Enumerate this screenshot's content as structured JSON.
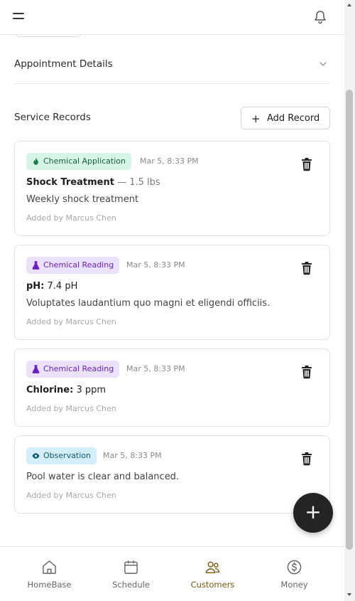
{
  "header": {
    "menu_icon": "hamburger-menu-icon",
    "notifications_icon": "bell-icon"
  },
  "appointment": {
    "title": "Appointment Details",
    "chevron_icon": "chevron-down-icon"
  },
  "service_records": {
    "title": "Service Records",
    "add_button": {
      "icon": "plus-icon",
      "label": "Add Record"
    },
    "records": [
      {
        "type": "Chemical Application",
        "type_icon": "flame-icon",
        "badge_color": "#d7f5e6",
        "timestamp": "Mar 5, 8:33 PM",
        "main_label": "Shock Treatment",
        "main_value": "— 1.5 lbs",
        "note": "Weekly shock treatment",
        "added_by": "Added by Marcus Chen"
      },
      {
        "type": "Chemical Reading",
        "type_icon": "flask-icon",
        "badge_color": "#ece1fb",
        "timestamp": "Mar 5, 8:33 PM",
        "main_label": "pH:",
        "main_value": "7.4 pH",
        "note": "Voluptates laudantium quo magni et eligendi officiis.",
        "added_by": "Added by Marcus Chen"
      },
      {
        "type": "Chemical Reading",
        "type_icon": "flask-icon",
        "badge_color": "#ece1fb",
        "timestamp": "Mar 5, 8:33 PM",
        "main_label": "Chlorine:",
        "main_value": "3 ppm",
        "added_by": "Added by Marcus Chen"
      },
      {
        "type": "Observation",
        "type_icon": "eye-icon",
        "badge_color": "#d5effa",
        "timestamp": "Mar 5, 8:33 PM",
        "note": "Pool water is clear and balanced.",
        "added_by": "Added by Marcus Chen"
      }
    ],
    "delete_icon": "trash-icon"
  },
  "fab": {
    "icon": "plus-icon",
    "symbol": "+"
  },
  "bottom_nav": {
    "items": [
      {
        "label": "HomeBase",
        "icon": "home-icon",
        "active": false
      },
      {
        "label": "Schedule",
        "icon": "calendar-icon",
        "active": false
      },
      {
        "label": "Customers",
        "icon": "users-icon",
        "active": true
      },
      {
        "label": "Money",
        "icon": "dollar-circle-icon",
        "active": false
      }
    ]
  },
  "colors": {
    "active_nav": "#7a5a0c",
    "fab": "#242424",
    "accent_green": "#14603c",
    "accent_purple": "#6a21c4",
    "accent_blue": "#0e5872"
  }
}
